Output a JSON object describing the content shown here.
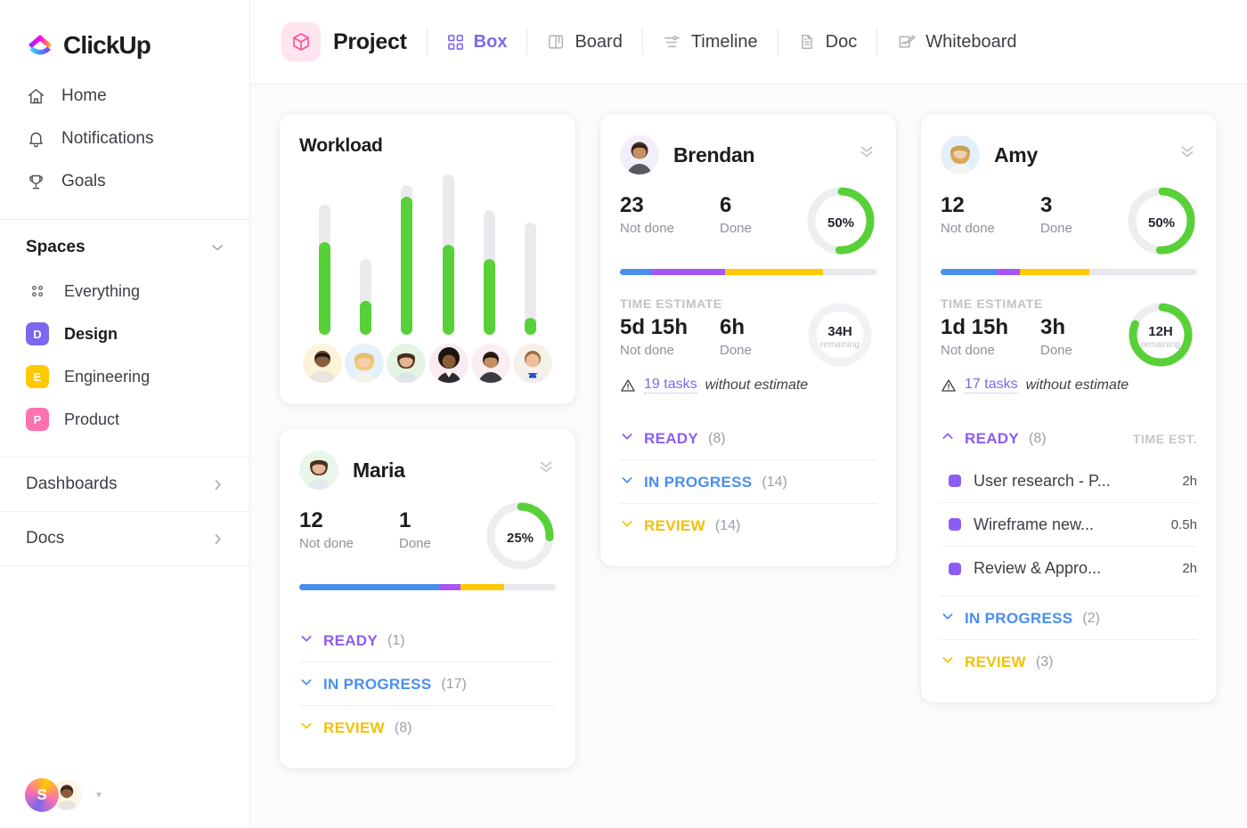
{
  "brand": {
    "name": "ClickUp",
    "logo_icon": "clickup-logo-icon"
  },
  "sidebar": {
    "nav": [
      {
        "label": "Home",
        "icon": "home-icon"
      },
      {
        "label": "Notifications",
        "icon": "bell-icon"
      },
      {
        "label": "Goals",
        "icon": "trophy-icon"
      }
    ],
    "spaces_section": {
      "title": "Spaces",
      "chevron": "chevron-down-icon"
    },
    "everything": {
      "label": "Everything",
      "icon": "grid-dots-icon"
    },
    "spaces": [
      {
        "label": "Design",
        "initial": "D",
        "color": "#7b68ee",
        "active": true
      },
      {
        "label": "Engineering",
        "initial": "E",
        "color": "#ffc800",
        "active": false
      },
      {
        "label": "Product",
        "initial": "P",
        "color": "#fd71af",
        "active": false
      }
    ],
    "footer_links": [
      {
        "label": "Dashboards",
        "icon": "chevron-right-icon"
      },
      {
        "label": "Docs",
        "icon": "chevron-right-icon"
      }
    ],
    "user": {
      "initial": "S",
      "caret": "caret-down-icon"
    }
  },
  "topbar": {
    "project_label": "Project",
    "project_icon": "cube-icon",
    "views": [
      {
        "label": "Box",
        "icon": "box-grid-icon",
        "active": true
      },
      {
        "label": "Board",
        "icon": "board-icon",
        "active": false
      },
      {
        "label": "Timeline",
        "icon": "timeline-icon",
        "active": false
      },
      {
        "label": "Doc",
        "icon": "doc-icon",
        "active": false
      },
      {
        "label": "Whiteboard",
        "icon": "whiteboard-icon",
        "active": false
      }
    ]
  },
  "workload": {
    "title": "Workload"
  },
  "chart_data": {
    "type": "bar",
    "title": "Workload",
    "xlabel": "",
    "ylabel": "",
    "ylim": [
      0,
      100
    ],
    "grid": false,
    "legend": "none",
    "categories": [
      "member-1",
      "member-2",
      "member-3",
      "member-4",
      "member-5",
      "member-6"
    ],
    "series": [
      {
        "name": "Capacity (track)",
        "values": [
          81,
          47,
          93,
          100,
          78,
          70
        ]
      },
      {
        "name": "Assigned (green fill)",
        "values": [
          58,
          21,
          86,
          56,
          47,
          10
        ]
      }
    ]
  },
  "cards": {
    "brendan": {
      "name": "Brendan",
      "collapse_icon": "chevron-double-down-icon",
      "not_done": {
        "value": "23",
        "label": "Not done"
      },
      "done": {
        "value": "6",
        "label": "Done"
      },
      "progress": {
        "main": "50%",
        "sub": "",
        "percent": 50
      },
      "segments": [
        {
          "name": "in-progress",
          "color": "#4a8ef0",
          "pct": 12
        },
        {
          "name": "ready",
          "color": "#a855f7",
          "pct": 29
        },
        {
          "name": "review",
          "color": "#ffc800",
          "pct": 38
        },
        {
          "name": "empty",
          "color": "#e7e8ec",
          "pct": 21
        }
      ],
      "time_estimate_label": "TIME ESTIMATE",
      "te_not_done": {
        "value": "5d 15h",
        "label": "Not done"
      },
      "te_done": {
        "value": "6h",
        "label": "Done"
      },
      "te_donut": {
        "main": "34H",
        "sub": "remaining",
        "percent": 0
      },
      "warning": {
        "icon": "warning-triangle-icon",
        "link": "19 tasks",
        "text": "without estimate"
      },
      "statuses": [
        {
          "name": "READY",
          "count": "(8)",
          "color_class": "s-ready",
          "chevron": "chevron-down-icon",
          "expanded": false
        },
        {
          "name": "IN PROGRESS",
          "count": "(14)",
          "color_class": "s-prog",
          "chevron": "chevron-down-icon",
          "expanded": false
        },
        {
          "name": "REVIEW",
          "count": "(14)",
          "color_class": "s-review",
          "chevron": "chevron-down-icon",
          "expanded": false
        }
      ]
    },
    "maria": {
      "name": "Maria",
      "collapse_icon": "chevron-double-down-icon",
      "not_done": {
        "value": "12",
        "label": "Not done"
      },
      "done": {
        "value": "1",
        "label": "Done"
      },
      "progress": {
        "main": "25%",
        "sub": "",
        "percent": 25
      },
      "segments": [
        {
          "name": "in-progress",
          "color": "#4a8ef0",
          "pct": 55
        },
        {
          "name": "ready",
          "color": "#a855f7",
          "pct": 8
        },
        {
          "name": "review",
          "color": "#ffc800",
          "pct": 17
        },
        {
          "name": "empty",
          "color": "#e7e8ec",
          "pct": 20
        }
      ],
      "statuses": [
        {
          "name": "READY",
          "count": "(1)",
          "color_class": "s-ready",
          "chevron": "chevron-down-icon",
          "expanded": false
        },
        {
          "name": "IN PROGRESS",
          "count": "(17)",
          "color_class": "s-prog",
          "chevron": "chevron-down-icon",
          "expanded": false
        },
        {
          "name": "REVIEW",
          "count": "(8)",
          "color_class": "s-review",
          "chevron": "chevron-down-icon",
          "expanded": false
        }
      ]
    },
    "amy": {
      "name": "Amy",
      "collapse_icon": "chevron-double-down-icon",
      "not_done": {
        "value": "12",
        "label": "Not done"
      },
      "done": {
        "value": "3",
        "label": "Done"
      },
      "progress": {
        "main": "50%",
        "sub": "",
        "percent": 50
      },
      "segments": [
        {
          "name": "in-progress",
          "color": "#4a8ef0",
          "pct": 22
        },
        {
          "name": "ready",
          "color": "#a855f7",
          "pct": 9
        },
        {
          "name": "review",
          "color": "#ffc800",
          "pct": 27
        },
        {
          "name": "empty",
          "color": "#e7e8ec",
          "pct": 42
        }
      ],
      "time_estimate_label": "TIME ESTIMATE",
      "te_not_done": {
        "value": "1d 15h",
        "label": "Not done"
      },
      "te_done": {
        "value": "3h",
        "label": "Done"
      },
      "te_donut": {
        "main": "12H",
        "sub": "remaining",
        "percent": 80
      },
      "warning": {
        "icon": "warning-triangle-icon",
        "link": "17 tasks",
        "text": "without estimate"
      },
      "ready_status": {
        "name": "READY",
        "count": "(8)",
        "chevron": "chevron-up-icon",
        "time_est_header": "TIME EST."
      },
      "tasks": [
        {
          "name": "User research - P...",
          "est": "2h",
          "dot_color": "#8b5cf6"
        },
        {
          "name": "Wireframe new...",
          "est": "0.5h",
          "dot_color": "#8b5cf6"
        },
        {
          "name": "Review & Appro...",
          "est": "2h",
          "dot_color": "#8b5cf6"
        }
      ],
      "statuses": [
        {
          "name": "IN PROGRESS",
          "count": "(2)",
          "color_class": "s-prog",
          "chevron": "chevron-down-icon",
          "expanded": false
        },
        {
          "name": "REVIEW",
          "count": "(3)",
          "color_class": "s-review",
          "chevron": "chevron-down-icon",
          "expanded": false
        }
      ]
    }
  },
  "colors": {
    "accent_purple": "#7b68ee",
    "green": "#58d138",
    "blue": "#4a8ef0",
    "yellow": "#ffc800",
    "pink": "#fd71af",
    "track_gray": "#e7e8ec"
  }
}
